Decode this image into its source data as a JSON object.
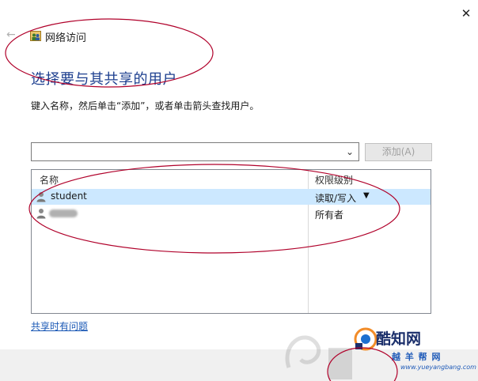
{
  "window": {
    "title": "网络访问",
    "close_glyph": "✕",
    "back_glyph": "←"
  },
  "main": {
    "heading": "选择要与其共享的用户",
    "instruction": "键入名称，然后单击“添加”，或者单击箭头查找用户。"
  },
  "add_user": {
    "combo_value": "",
    "chevron_glyph": "⌄",
    "add_label": "添加(A)"
  },
  "user_list": {
    "columns": [
      "名称",
      "权限级别"
    ],
    "rows": [
      {
        "name": "student",
        "permission": "读取/写入",
        "selected": true,
        "has_dropdown": true
      },
      {
        "name": "",
        "permission": "所有者",
        "selected": false,
        "has_dropdown": false
      }
    ]
  },
  "help_link": "共享时有问题",
  "watermark": {
    "brand": "酷知网",
    "cn": "越 羊 帮 网",
    "url": "www.yueyangbang.com"
  },
  "colors": {
    "heading": "#1d3f8f",
    "selected_row": "#cce8ff",
    "link": "#1a58b5",
    "annotation": "#b0002a"
  }
}
